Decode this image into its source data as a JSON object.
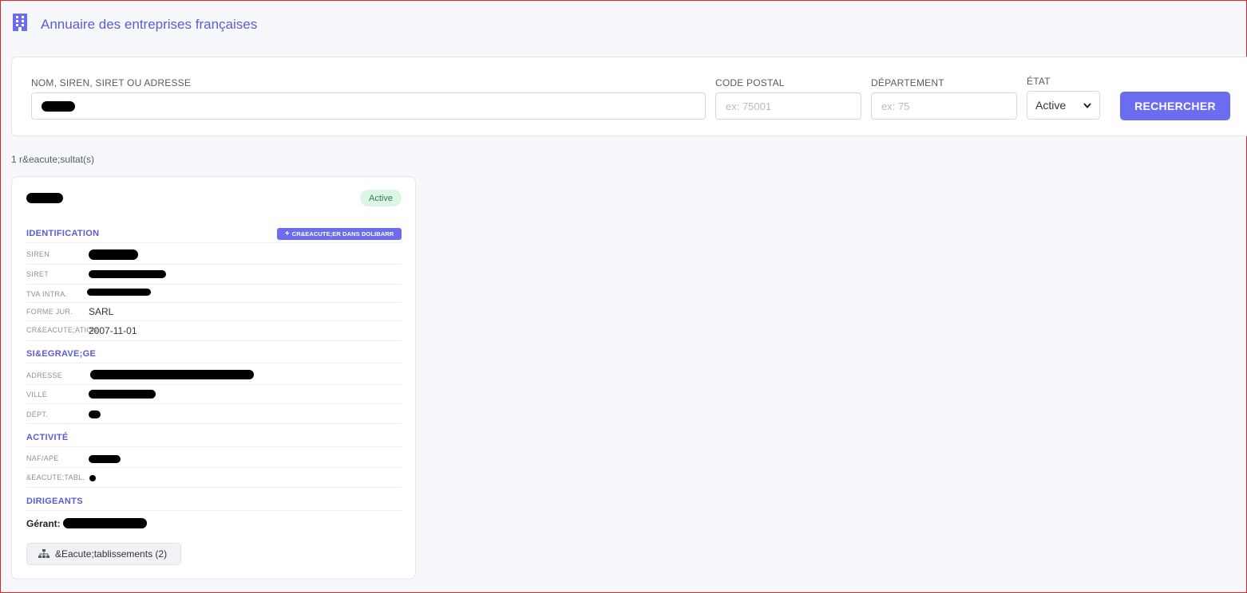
{
  "header": {
    "title": "Annuaire des entreprises françaises",
    "icon": "building-icon"
  },
  "search": {
    "query_label": "NOM, SIREN, SIRET OU ADRESSE",
    "query_value": "",
    "postal_label": "CODE POSTAL",
    "postal_placeholder": "ex: 75001",
    "dept_label": "DÉPARTEMENT",
    "dept_placeholder": "ex: 75",
    "state_label": "ÉTAT",
    "state_value": "Active",
    "submit_label": "RECHERCHER"
  },
  "results": {
    "count_text": "1 r&eacute;sultat(s)"
  },
  "card": {
    "status": "Active",
    "create_button": "CR&EACUTE;ER DANS DOLIBARR",
    "sections": {
      "identification": "IDENTIFICATION",
      "siege": "SI&EGRAVE;GE",
      "activite": "ACTIVITÉ",
      "dirigeants": "DIRIGEANTS"
    },
    "identification": {
      "siren_label": "SIREN",
      "siret_label": "SIRET",
      "tva_label": "TVA INTRA.",
      "forme_label": "FORME JUR.",
      "forme_value": "SARL",
      "creation_label": "CR&EACUTE;ATION",
      "creation_value": "2007-11-01"
    },
    "siege": {
      "adresse_label": "ADRESSE",
      "ville_label": "VILLE",
      "dept_label": "DÉPT."
    },
    "activite": {
      "naf_label": "NAF/APE",
      "etab_label": "&EACUTE;TABL."
    },
    "dirigeants": {
      "role": "Gérant:"
    },
    "establishments_button": "&Eacute;tablissements (2)"
  },
  "colors": {
    "accent": "#6c6cf0",
    "accent_text": "#5b5bd6",
    "status_bg": "#dcf5e5",
    "status_text": "#2e7d4a"
  }
}
